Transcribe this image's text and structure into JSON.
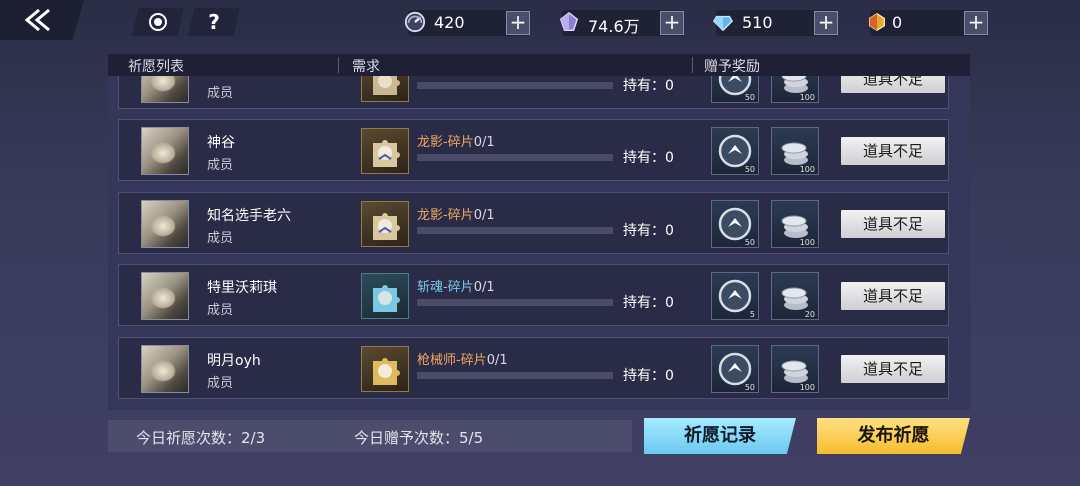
{
  "topbar": {
    "resources": [
      {
        "name": "energy",
        "icon": "energy-gauge-icon",
        "value": "420"
      },
      {
        "name": "crystal",
        "icon": "purple-crystal-icon",
        "value": "74.6万"
      },
      {
        "name": "diamond",
        "icon": "blue-diamond-icon",
        "value": "510"
      },
      {
        "name": "gem",
        "icon": "gold-gem-icon",
        "value": "0"
      }
    ],
    "plus_label": "+",
    "help_label": "?"
  },
  "headers": {
    "list": "祈愿列表",
    "need": "需求",
    "reward": "赠予奖励"
  },
  "rows": [
    {
      "name": "",
      "role": "成员",
      "fragment": "",
      "count": "",
      "hold": "持有：0",
      "rewards": [
        "50",
        "100"
      ],
      "status": "道具不足",
      "rarity": "gold"
    },
    {
      "name": "神谷",
      "role": "成员",
      "fragment": "龙影-碎片",
      "count": "0/1",
      "hold": "持有：0",
      "rewards": [
        "50",
        "100"
      ],
      "status": "道具不足",
      "rarity": "gold"
    },
    {
      "name": "知名选手老六",
      "role": "成员",
      "fragment": "龙影-碎片",
      "count": "0/1",
      "hold": "持有：0",
      "rewards": [
        "50",
        "100"
      ],
      "status": "道具不足",
      "rarity": "gold"
    },
    {
      "name": "特里沃莉琪",
      "role": "成员",
      "fragment": "斩魂-碎片",
      "count": "0/1",
      "hold": "持有：0",
      "rewards": [
        "5",
        "20"
      ],
      "status": "道具不足",
      "rarity": "blue"
    },
    {
      "name": "明月oyh",
      "role": "成员",
      "fragment": "枪械师-碎片",
      "count": "0/1",
      "hold": "持有：0",
      "rewards": [
        "50",
        "100"
      ],
      "status": "道具不足",
      "rarity": "gold"
    }
  ],
  "footer": {
    "wish_count": "今日祈愿次数：2/3",
    "gift_count": "今日赠予次数：5/5",
    "record_button": "祈愿记录",
    "publish_button": "发布祈愿"
  },
  "colors": {
    "gold_fragment_text": "#f0a860",
    "blue_fragment_text": "#7fc8ee",
    "record_button": "#8fdcf8",
    "publish_button": "#f8cc45"
  }
}
